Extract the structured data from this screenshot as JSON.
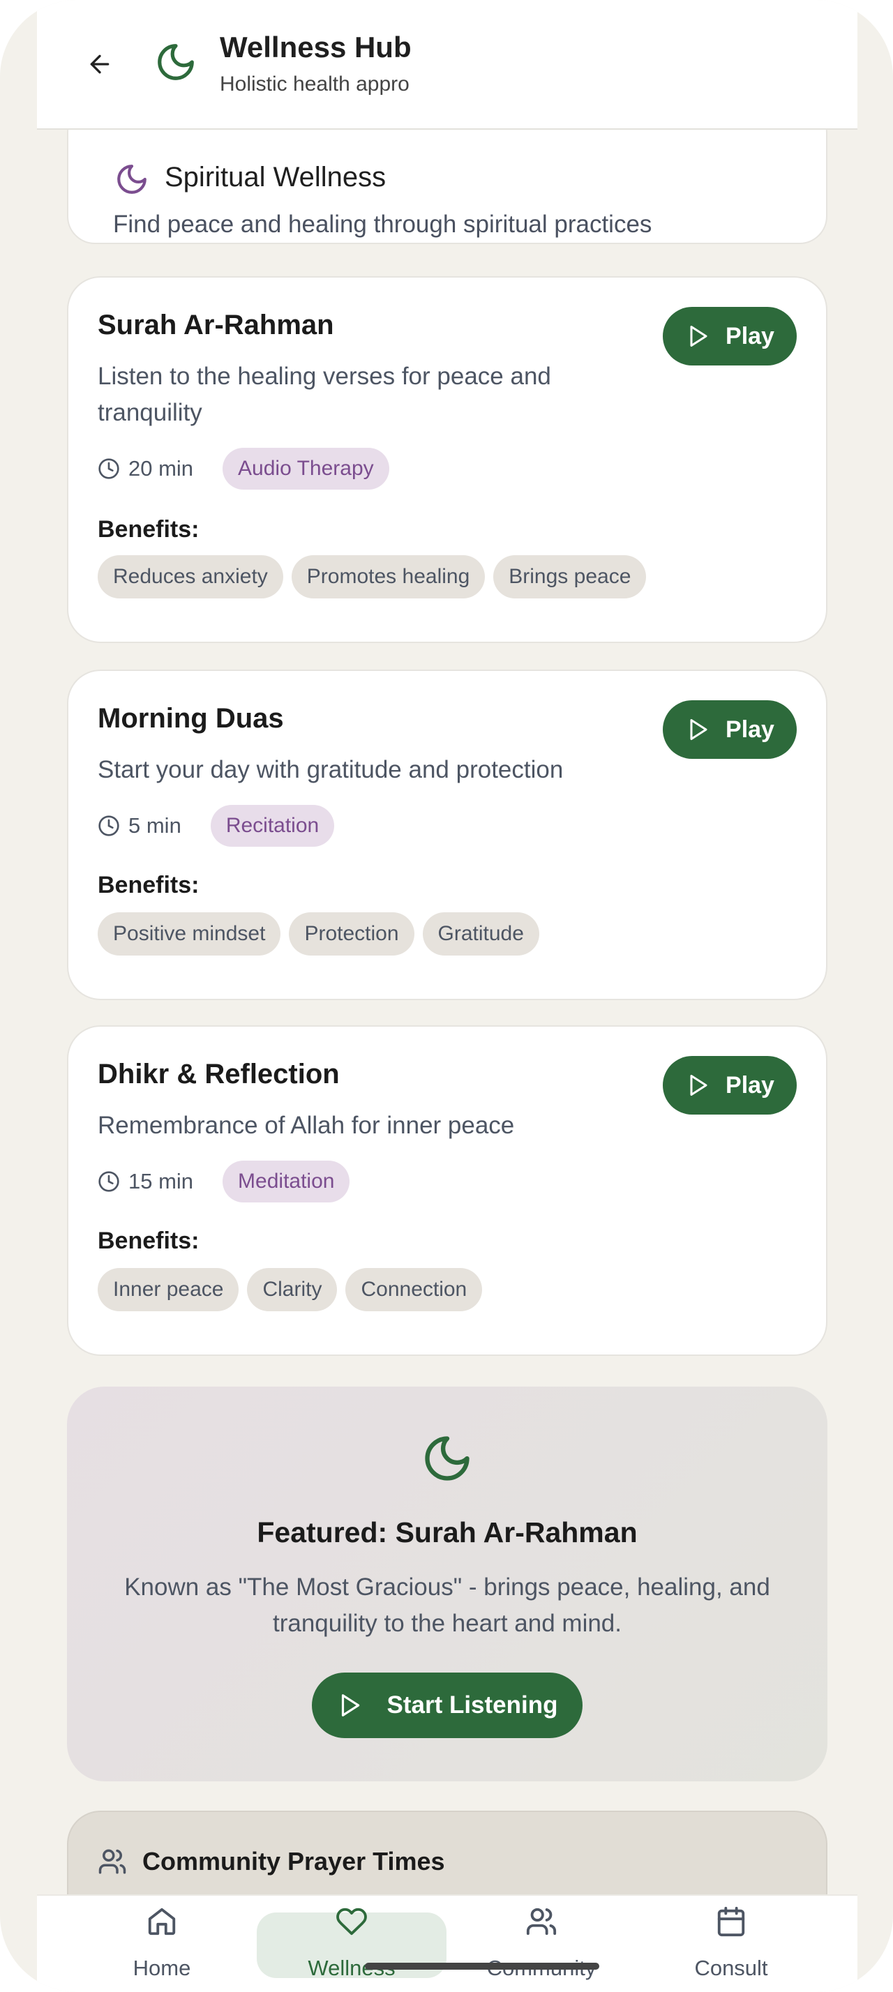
{
  "header": {
    "title": "Wellness Hub",
    "subtitle": "Holistic health appro"
  },
  "section": {
    "title": "Spiritual Wellness",
    "subtitle": "Find peace and healing through spiritual practices"
  },
  "sessions": [
    {
      "title": "Surah Ar-Rahman",
      "description": "Listen to the healing verses for peace and tranquility",
      "duration": "20 min",
      "tag": "Audio Therapy",
      "play_label": "Play",
      "benefits_label": "Benefits:",
      "benefits": [
        "Reduces anxiety",
        "Promotes healing",
        "Brings peace"
      ]
    },
    {
      "title": "Morning Duas",
      "description": "Start your day with gratitude and protection",
      "duration": "5 min",
      "tag": "Recitation",
      "play_label": "Play",
      "benefits_label": "Benefits:",
      "benefits": [
        "Positive mindset",
        "Protection",
        "Gratitude"
      ]
    },
    {
      "title": "Dhikr & Reflection",
      "description": "Remembrance of Allah for inner peace",
      "duration": "15 min",
      "tag": "Meditation",
      "play_label": "Play",
      "benefits_label": "Benefits:",
      "benefits": [
        "Inner peace",
        "Clarity",
        "Connection"
      ]
    }
  ],
  "featured": {
    "title": "Featured: Surah Ar-Rahman",
    "description": "Known as \"The Most Gracious\" - brings peace, healing, and tranquility to the heart and mind.",
    "button_label": "Start Listening"
  },
  "community": {
    "title": "Community Prayer Times"
  },
  "nav": {
    "items": [
      {
        "label": "Home",
        "icon": "home-icon"
      },
      {
        "label": "Wellness",
        "icon": "heart-icon"
      },
      {
        "label": "Community",
        "icon": "users-icon"
      },
      {
        "label": "Consult",
        "icon": "calendar-icon"
      }
    ],
    "active": "Wellness"
  },
  "colors": {
    "primary_green": "#2d6a3b",
    "purple": "#7b4d8f",
    "background": "#f3f1eb"
  }
}
